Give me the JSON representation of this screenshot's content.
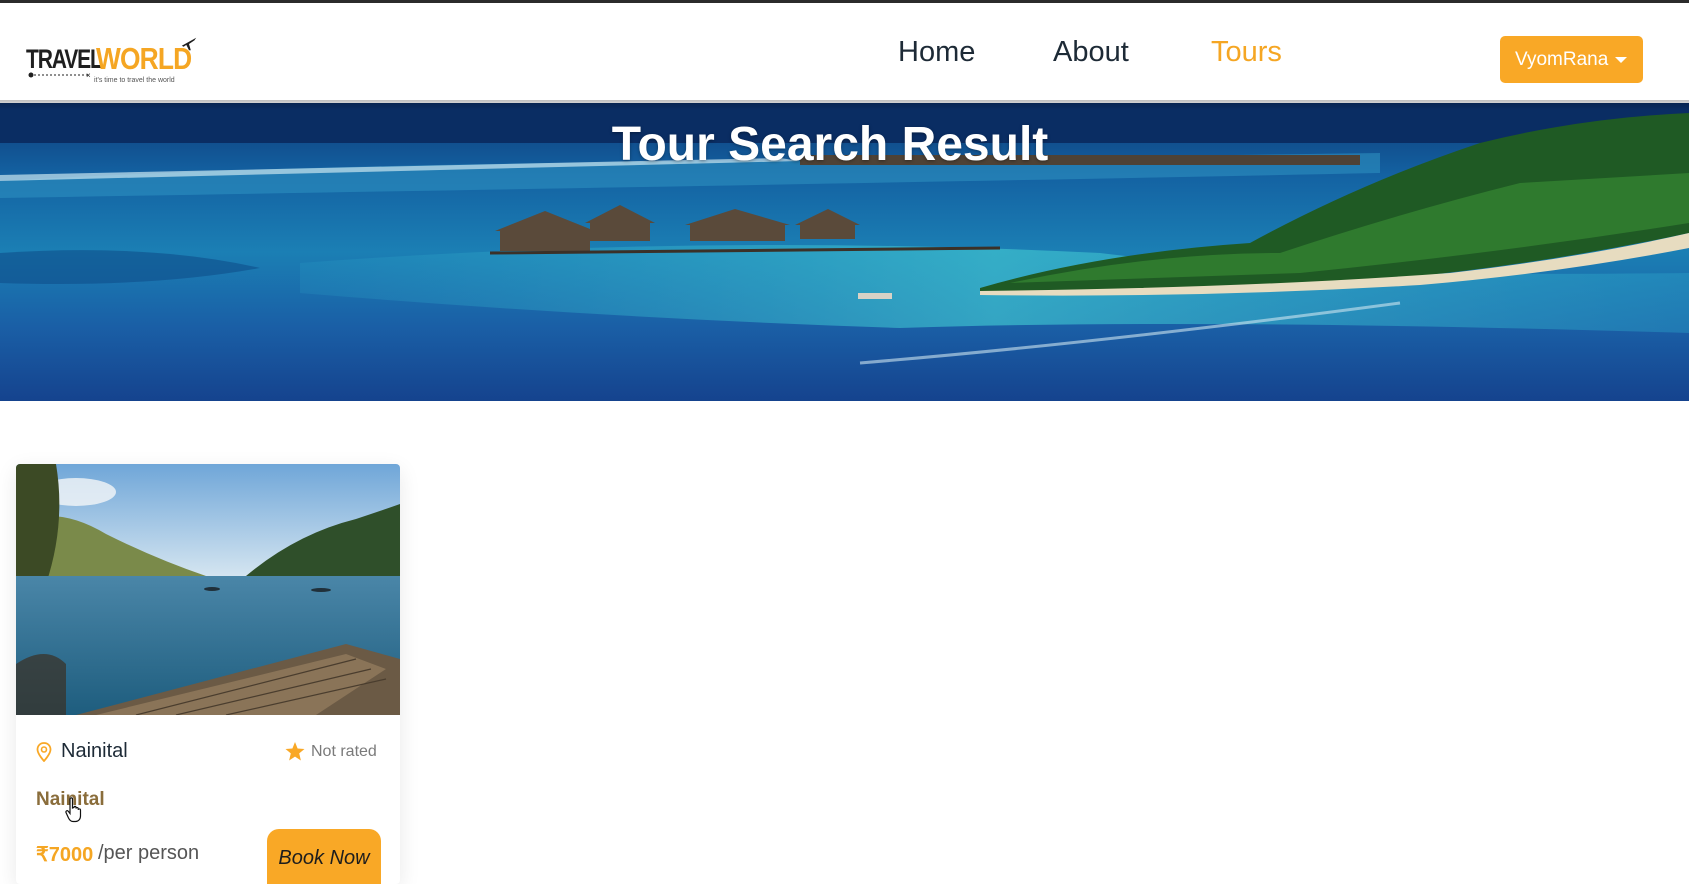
{
  "header": {
    "logo": {
      "word_travel": "TRAVEL",
      "word_world": "WORLD",
      "tagline": "it's time to travel the world"
    },
    "nav": [
      {
        "label": "Home",
        "active": false
      },
      {
        "label": "About",
        "active": false
      },
      {
        "label": "Tours",
        "active": true
      }
    ],
    "user_menu": {
      "label": "VyomRana"
    }
  },
  "hero": {
    "title": "Tour Search Result"
  },
  "results": [
    {
      "location": "Nainital",
      "rating": "Not rated",
      "title": "Nainital",
      "price": "₹7000",
      "price_unit": "/per person",
      "book_label": "Book Now"
    }
  ],
  "colors": {
    "accent": "#f9a826",
    "nav_text": "#1d2a36",
    "title_brown": "#8a6d3b"
  }
}
